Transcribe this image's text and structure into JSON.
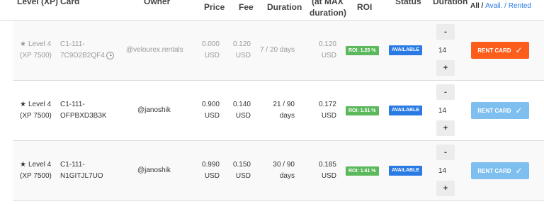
{
  "header": {
    "level": "Level (XP)",
    "card": "Card",
    "owner": "Owner",
    "price": "Price",
    "fee": "Fee",
    "duration": "Duration",
    "total_line1": "(at MAX",
    "total_line2": "duration)",
    "roi": "ROI",
    "status": "Status",
    "rent_duration": "Duration",
    "filter_all": "All",
    "filter_sep1": " / ",
    "filter_avail": "Avail.",
    "filter_sep2": " / ",
    "filter_rented": "Rented"
  },
  "rows": [
    {
      "level": "Level 4",
      "xp": "(XP 7500)",
      "card_l1": "C1-111-",
      "card_l2": "7C9D2B2QF4",
      "owner": "@velourex.rentals",
      "price": "0.000",
      "price_unit": "USD",
      "fee": "0.120",
      "fee_unit": "USD",
      "duration": "7 / 20 days",
      "total": "0.120",
      "total_unit": "USD",
      "roi": "ROI: 1.25 %",
      "status": "AVAILABLE",
      "minus": "-",
      "qty": "14",
      "plus": "+",
      "btn": "RENT CARD",
      "check": "✓"
    },
    {
      "level": "Level 4",
      "xp": "(XP 7500)",
      "card_l1": "C1-111-",
      "card_l2": "OFPBXD3B3K",
      "owner": "@janoshik",
      "price": "0.900",
      "price_unit": "USD",
      "fee": "0.140",
      "fee_unit": "USD",
      "duration_l1": "21 / 90",
      "duration_l2": "days",
      "total": "0.172",
      "total_unit": "USD",
      "roi": "ROI: 1.51 %",
      "status": "AVAILABLE",
      "minus": "-",
      "qty": "14",
      "plus": "+",
      "btn": "RENT CARD",
      "check": "✓"
    },
    {
      "level": "Level 4",
      "xp": "(XP 7500)",
      "card_l1": "C1-111-",
      "card_l2": "N1GITJL7UO",
      "owner": "@janoshik",
      "price": "0.990",
      "price_unit": "USD",
      "fee": "0.150",
      "fee_unit": "USD",
      "duration_l1": "30 / 90",
      "duration_l2": "days",
      "total": "0.185",
      "total_unit": "USD",
      "roi": "ROI: 1.61 %",
      "status": "AVAILABLE",
      "minus": "-",
      "qty": "14",
      "plus": "+",
      "btn": "RENT CARD",
      "check": "✓"
    }
  ],
  "colors": {
    "rent_button_active": "#fc5d1a",
    "rent_button_disabled": "#7fbff0",
    "roi_badge": "#5cb85c",
    "status_badge": "#2a7ae4",
    "filter_link": "#2a7ae4"
  },
  "icons": {
    "level": "star-icon",
    "alarm": "alarm-clock-icon",
    "rent": "check-icon"
  }
}
